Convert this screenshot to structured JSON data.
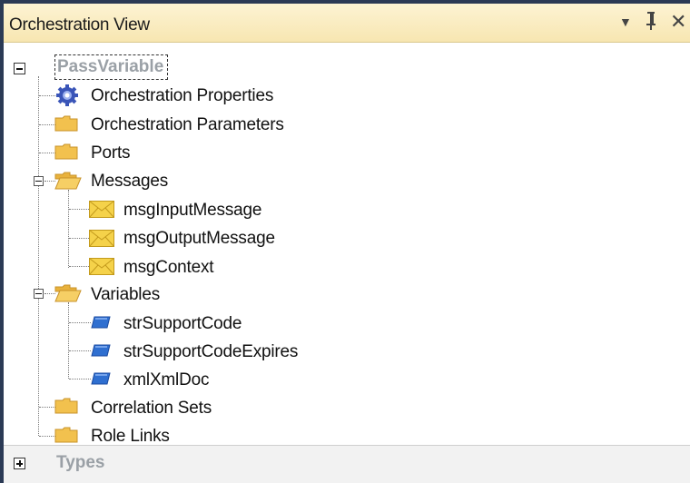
{
  "window": {
    "title": "Orchestration View",
    "buttons": {
      "dropdown": "▾",
      "pin": "Ԅ",
      "close": "✕"
    }
  },
  "tree": {
    "root": "PassVariable",
    "items": {
      "orch_properties": "Orchestration Properties",
      "orch_parameters": "Orchestration Parameters",
      "ports": "Ports",
      "messages": "Messages",
      "msg_input": "msgInputMessage",
      "msg_output": "msgOutputMessage",
      "msg_context": "msgContext",
      "variables": "Variables",
      "var_support_code": "strSupportCode",
      "var_support_expires": "strSupportCodeExpires",
      "var_xml_doc": "xmlXmlDoc",
      "correlation_sets": "Correlation Sets",
      "role_links": "Role Links"
    }
  },
  "footer": {
    "types": "Types"
  },
  "colors": {
    "titlebar": "#f7e6b1",
    "frame": "#2b3a55",
    "folder": "#f2c14e",
    "envelope": "#f5d24a",
    "variable": "#2f6fd0"
  }
}
